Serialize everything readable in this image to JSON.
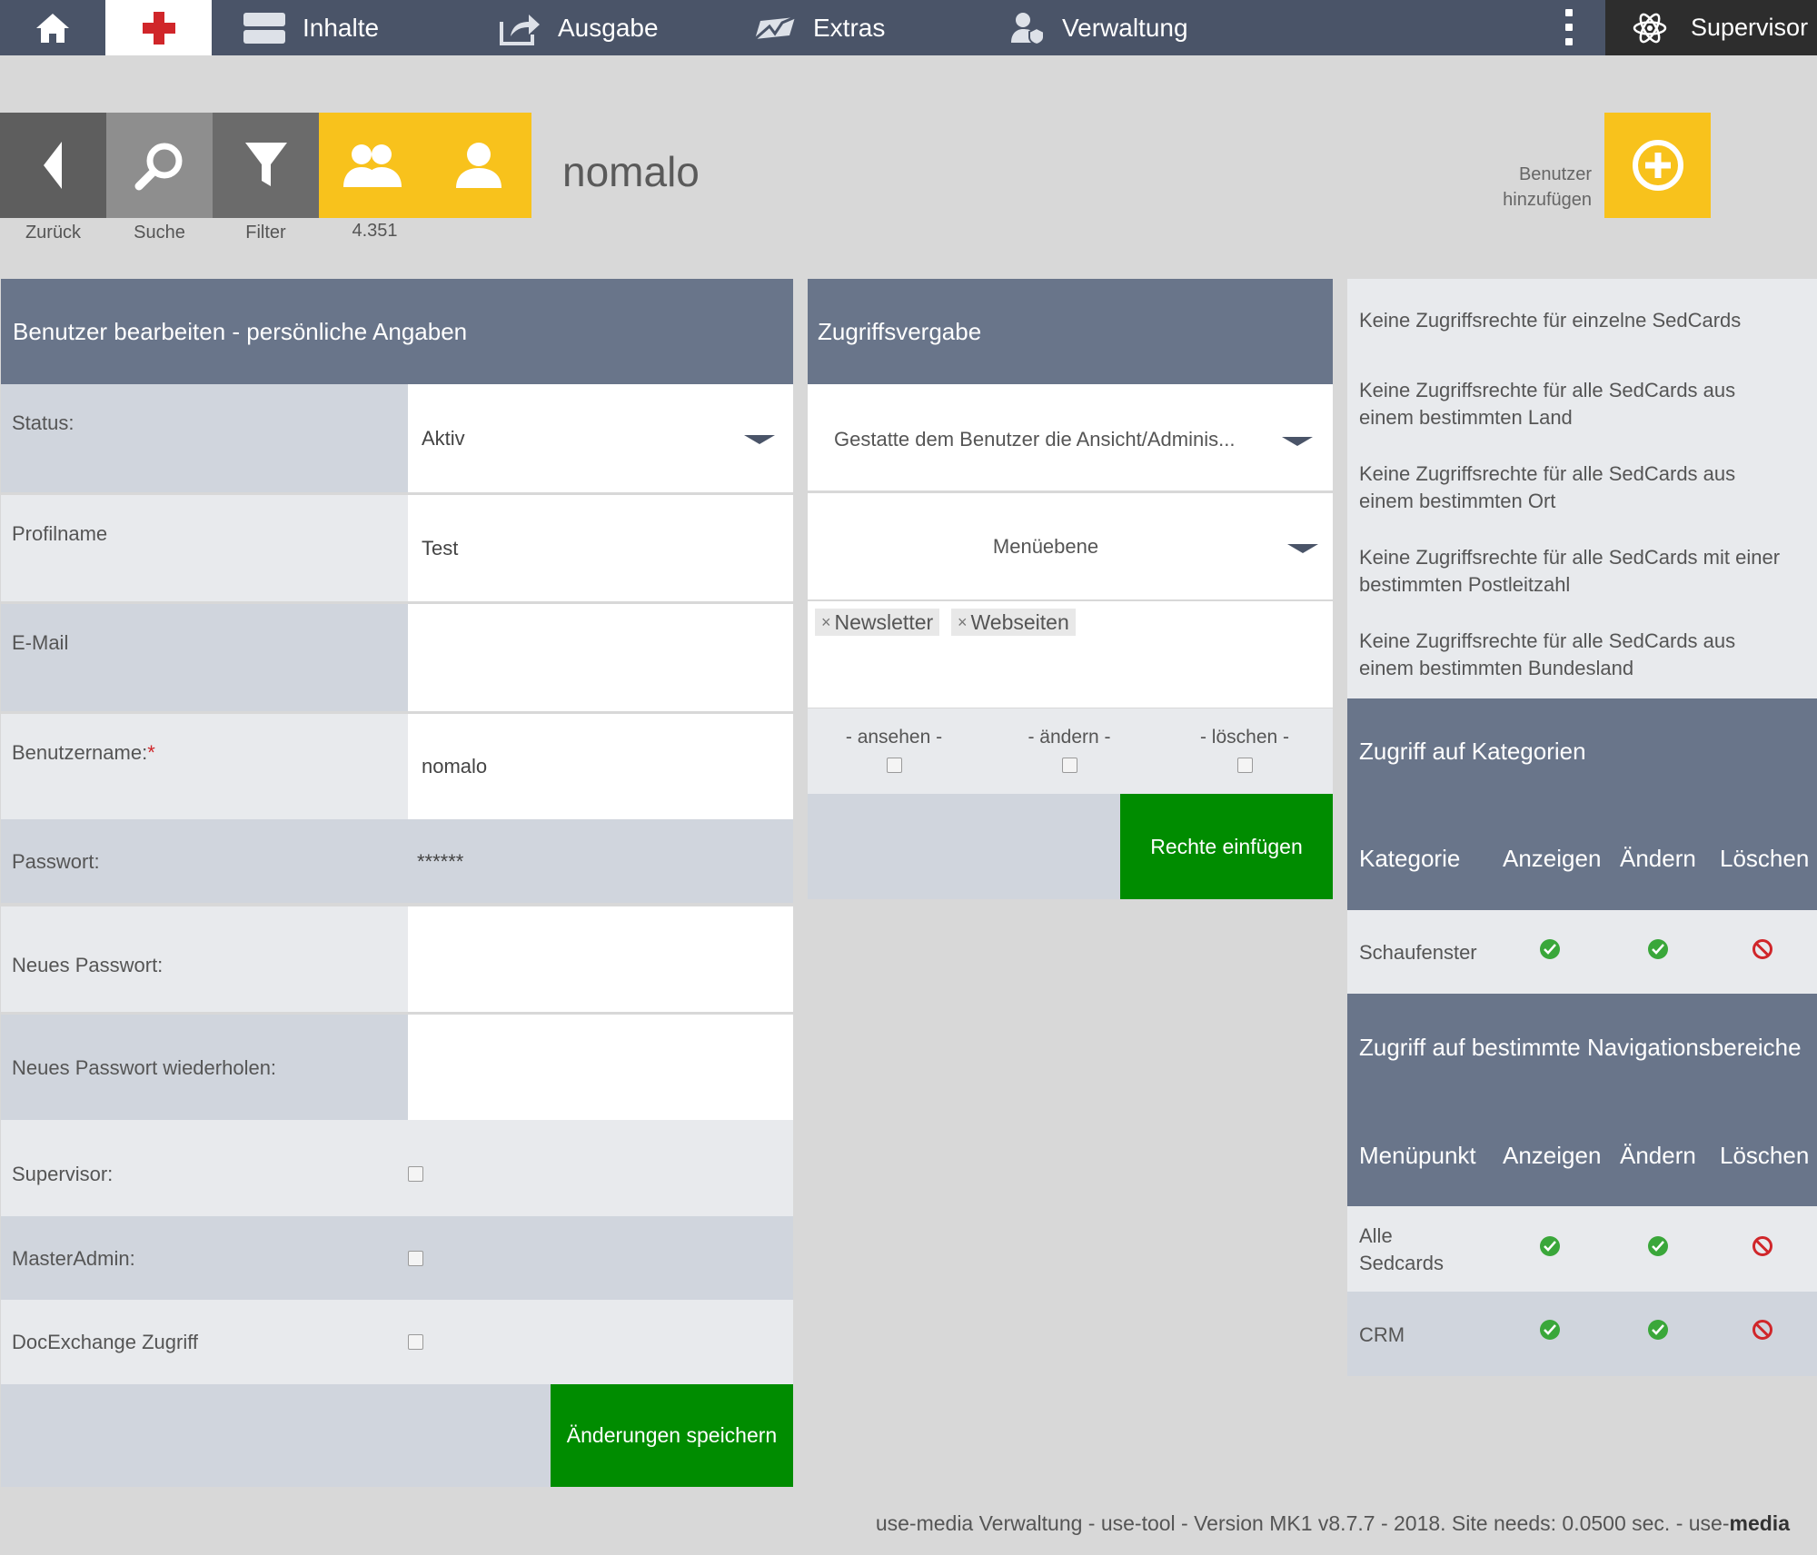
{
  "topnav": {
    "inhalte": "Inhalte",
    "ausgabe": "Ausgabe",
    "extras": "Extras",
    "verwaltung": "Verwaltung",
    "supervisor": "Supervisor"
  },
  "toolbar": {
    "back": "Zurück",
    "search": "Suche",
    "filter": "Filter",
    "count": "4.351"
  },
  "page_title": "nomalo",
  "add_user": {
    "line1": "Benutzer",
    "line2": "hinzufügen"
  },
  "form": {
    "header": "Benutzer bearbeiten - persönliche Angaben",
    "status_label": "Status:",
    "status_value": "Aktiv",
    "profilname_label": "Profilname",
    "profilname_value": "Test",
    "email_label": "E-Mail",
    "email_value": "",
    "username_label": "Benutzername:",
    "username_required": "*",
    "username_value": "nomalo",
    "password_label": "Passwort:",
    "password_value": "******",
    "new_password_label": "Neues Passwort:",
    "repeat_password_label": "Neues Passwort wiederholen:",
    "supervisor_label": "Supervisor:",
    "masteradmin_label": "MasterAdmin:",
    "docexchange_label": "DocExchange Zugriff",
    "save_label": "Änderungen speichern"
  },
  "access": {
    "header": "Zugriffsvergabe",
    "select_value": "Gestatte dem Benutzer die Ansicht/Adminis...",
    "level_value": "Menüebene",
    "tags": [
      "Newsletter",
      "Webseiten"
    ],
    "view": "- ansehen -",
    "change": "- ändern -",
    "delete": "- löschen -",
    "insert_label": "Rechte einfügen"
  },
  "info": {
    "l1": "Keine Zugriffsrechte für einzelne SedCards",
    "l2a": "Keine Zugriffsrechte für alle SedCards aus",
    "l2b": "einem bestimmten Land",
    "l3a": "Keine Zugriffsrechte für alle SedCards aus",
    "l3b": "einem bestimmten Ort",
    "l4a": "Keine Zugriffsrechte für alle SedCards mit einer",
    "l4b": "bestimmten Postleitzahl",
    "l5a": "Keine Zugriffsrechte für alle SedCards aus",
    "l5b": "einem bestimmten Bundesland"
  },
  "categories": {
    "header": "Zugriff auf Kategorien",
    "col_name": "Kategorie",
    "col_view": "Anzeigen",
    "col_change": "Ändern",
    "col_delete": "Löschen",
    "row1": "Schaufenster"
  },
  "nav_areas": {
    "header": "Zugriff auf bestimmte Navigationsbereiche",
    "col_name": "Menüpunkt",
    "col_view": "Anzeigen",
    "col_change": "Ändern",
    "col_delete": "Löschen",
    "row1a": "Alle",
    "row1b": "Sedcards",
    "row2": "CRM"
  },
  "footer": {
    "text": "use-media Verwaltung - use-tool - Version MK1 v8.7.7 - 2018. Site needs: 0.0500 sec. - use-",
    "brand": "media"
  },
  "colors": {
    "nav_bg": "#4a5468",
    "header_bg": "#69758a",
    "accent_yellow": "#f8c21c",
    "success_green": "#008c00",
    "deny_red": "#d0262a"
  }
}
